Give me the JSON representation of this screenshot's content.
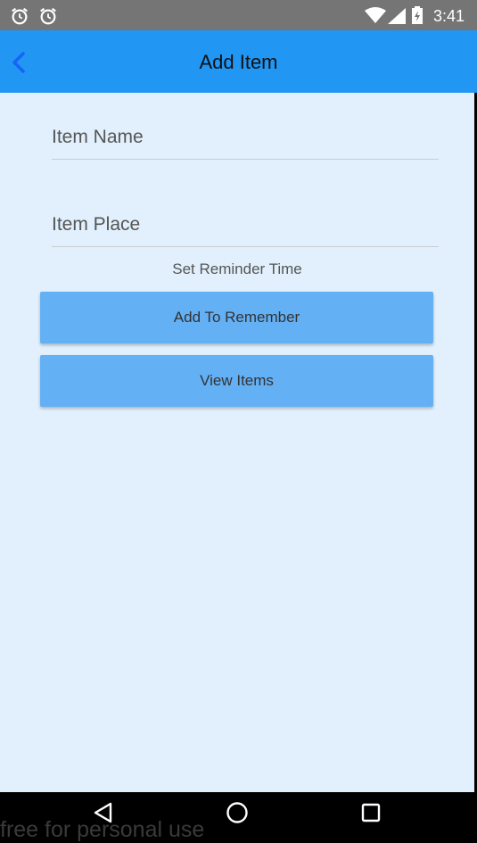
{
  "status_bar": {
    "time": "3:41",
    "icons": [
      "alarm-clock-icon",
      "alarm-clock-icon",
      "wifi-icon",
      "signal-icon",
      "battery-icon"
    ]
  },
  "app_bar": {
    "title": "Add Item",
    "back_icon": "back-chevron-icon"
  },
  "form": {
    "item_name_placeholder": "Item Name",
    "item_name_value": "",
    "item_place_placeholder": "Item Place",
    "item_place_value": "",
    "reminder_label": "Set Reminder Time"
  },
  "buttons": {
    "add_label": "Add To Remember",
    "view_label": "View Items"
  },
  "nav_bar": {
    "icons": [
      "back-triangle-icon",
      "home-circle-icon",
      "recents-square-icon"
    ]
  },
  "watermark": "free for personal use",
  "colors": {
    "app_bar": "#2196F3",
    "background": "#E1F0FC",
    "button": "#64B0F4",
    "status_bar": "#757575"
  }
}
